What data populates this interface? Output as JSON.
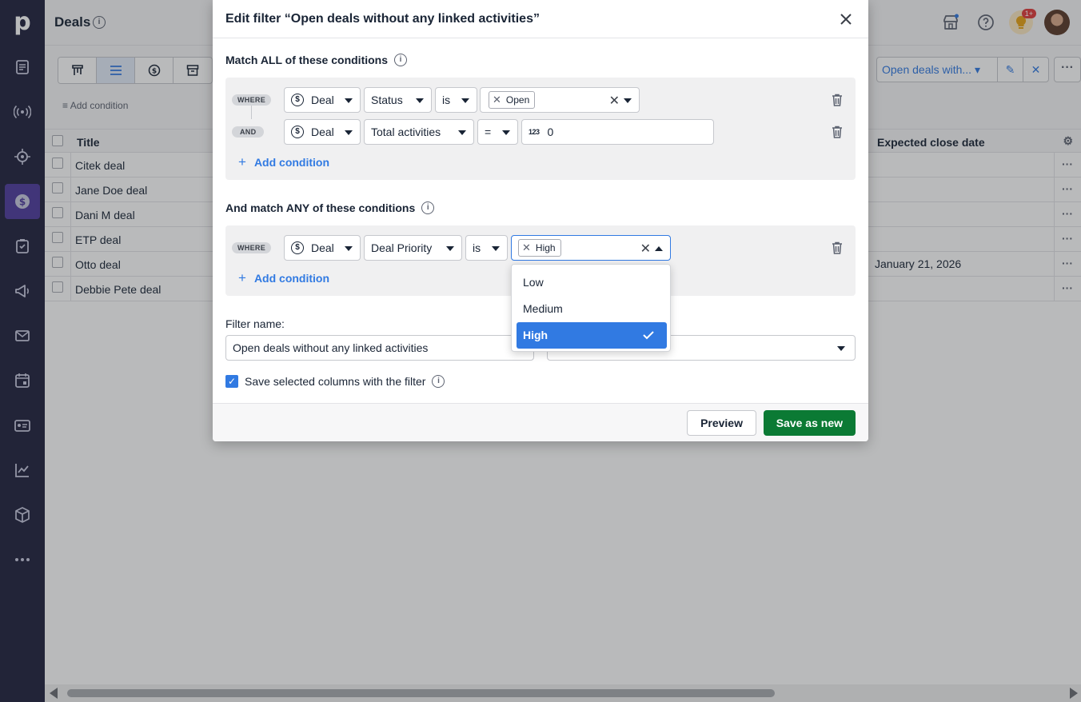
{
  "page": {
    "title": "Deals",
    "notification_badge": "1+"
  },
  "toolbar": {
    "add_condition": "Add condition",
    "filter_name": "Open deals with..."
  },
  "table": {
    "columns": [
      "Title",
      "Expected close date"
    ],
    "rows": [
      {
        "title": "Citek deal",
        "close_date": ""
      },
      {
        "title": "Jane Doe deal",
        "close_date": ""
      },
      {
        "title": "Dani M deal",
        "close_date": ""
      },
      {
        "title": "ETP deal",
        "close_date": ""
      },
      {
        "title": "Otto deal",
        "close_date": "January 21, 2026"
      },
      {
        "title": "Debbie Pete deal",
        "close_date": ""
      }
    ]
  },
  "modal": {
    "title": "Edit filter “Open deals without any linked activities”",
    "match_all_title": "Match ALL of these conditions",
    "match_any_title": "And match ANY of these conditions",
    "add_condition": "Add condition",
    "all_conditions": [
      {
        "tag": "WHERE",
        "entity": "Deal",
        "field": "Status",
        "operator": "is",
        "value": "Open"
      },
      {
        "tag": "AND",
        "entity": "Deal",
        "field": "Total activities",
        "operator": "=",
        "value": "0",
        "value_icon": "123"
      }
    ],
    "any_conditions": [
      {
        "tag": "WHERE",
        "entity": "Deal",
        "field": "Deal Priority",
        "operator": "is",
        "value": "High"
      }
    ],
    "filter_name_label": "Filter name:",
    "filter_name_value": "Open deals without any linked activities",
    "save_columns_label": "Save selected columns with the filter",
    "save_columns_checked": true,
    "preview_button": "Preview",
    "save_button": "Save as new"
  },
  "dropdown": {
    "options": [
      "Low",
      "Medium",
      "High"
    ],
    "selected": "High"
  },
  "colors": {
    "sidebar": "#21233f",
    "sidebar_active": "#4f3c9e",
    "accent": "#317ae2",
    "save_green": "#0b7a34"
  }
}
